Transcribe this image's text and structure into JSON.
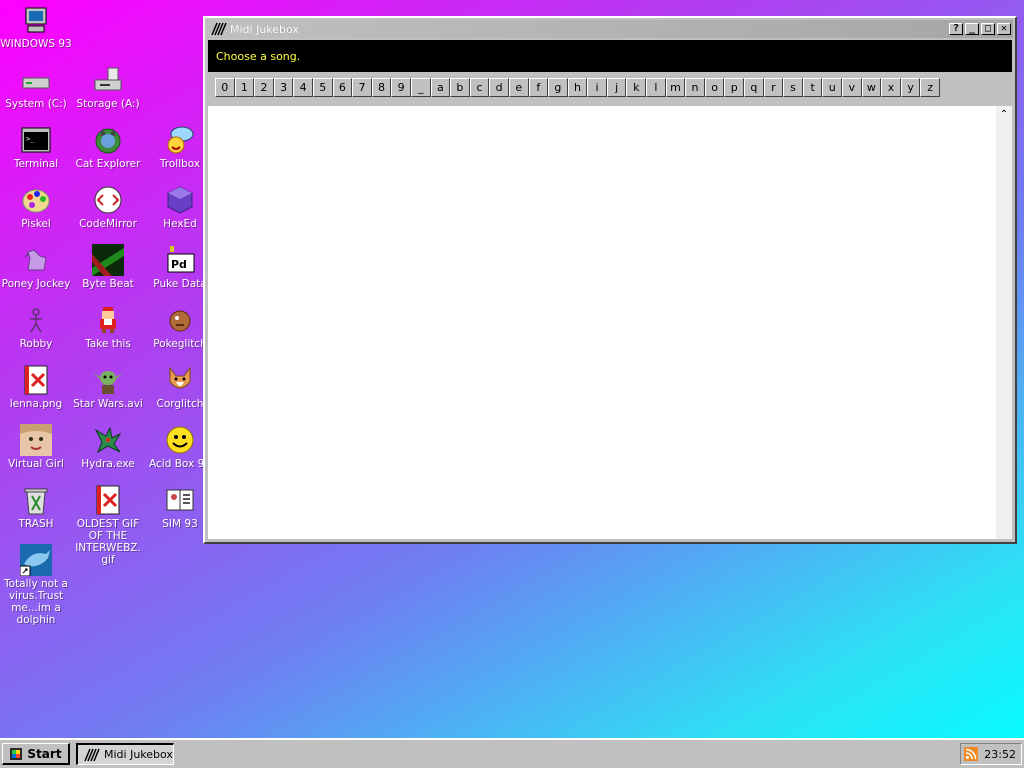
{
  "desktop": {
    "icons": [
      {
        "label": "WINDOWS 93",
        "icon": "computer-icon"
      },
      {
        "label": "System (C:)",
        "icon": "drive-icon"
      },
      {
        "label": "Storage (A:)",
        "icon": "floppy-drive-icon"
      },
      {
        "label": "Terminal",
        "icon": "terminal-icon"
      },
      {
        "label": "Cat Explorer",
        "icon": "cat-globe-icon"
      },
      {
        "label": "Trollbox",
        "icon": "chat-icon"
      },
      {
        "label": "Piskel",
        "icon": "palette-icon"
      },
      {
        "label": "CodeMirror",
        "icon": "code-icon"
      },
      {
        "label": "HexEd",
        "icon": "hex-cube-icon"
      },
      {
        "label": "Poney Jockey",
        "icon": "pony-icon"
      },
      {
        "label": "Byte Beat",
        "icon": "byte-beat-icon"
      },
      {
        "label": "Puke Data",
        "icon": "pd-icon"
      },
      {
        "label": "Robby",
        "icon": "stick-figure-icon"
      },
      {
        "label": "Take this",
        "icon": "pixel-character-icon"
      },
      {
        "label": "Pokeglitch",
        "icon": "pokeglitch-icon"
      },
      {
        "label": "lenna.png",
        "icon": "image-file-icon"
      },
      {
        "label": "Star Wars.avi",
        "icon": "yoda-icon"
      },
      {
        "label": "Corglitch",
        "icon": "corgi-icon"
      },
      {
        "label": "Virtual Girl",
        "icon": "face-icon"
      },
      {
        "label": "Hydra.exe",
        "icon": "dragon-icon"
      },
      {
        "label": "Acid Box 93",
        "icon": "smiley-icon"
      },
      {
        "label": "TRASH",
        "icon": "trash-icon"
      },
      {
        "label": "OLDEST GIF OF THE INTERWEBZ.gif",
        "icon": "gif-file-icon"
      },
      {
        "label": "SIM 93",
        "icon": "sim-book-icon"
      },
      {
        "label": "Totally not a virus.Trust me...im a dolphin",
        "icon": "dolphin-icon"
      }
    ]
  },
  "window": {
    "title": "Midi Jukebox",
    "help_label": "?",
    "minimize_label": "_",
    "maximize_label": "□",
    "close_label": "✕",
    "song_prompt": "Choose a song.",
    "letters": [
      "0",
      "1",
      "2",
      "3",
      "4",
      "5",
      "6",
      "7",
      "8",
      "9",
      "_",
      "a",
      "b",
      "c",
      "d",
      "e",
      "f",
      "g",
      "h",
      "i",
      "j",
      "k",
      "l",
      "m",
      "n",
      "o",
      "p",
      "q",
      "r",
      "s",
      "t",
      "u",
      "v",
      "w",
      "x",
      "y",
      "z"
    ],
    "scroll_up_label": "⌃"
  },
  "taskbar": {
    "start_label": "Start",
    "task_label": "Midi Jukebox",
    "clock": "23:52"
  },
  "colors": {
    "bg_top_left": "#ff00ff",
    "bg_bottom_right": "#00ffff",
    "song_bar_bg": "#000000",
    "song_text": "#ffff40",
    "chrome": "#c0c0c0"
  }
}
